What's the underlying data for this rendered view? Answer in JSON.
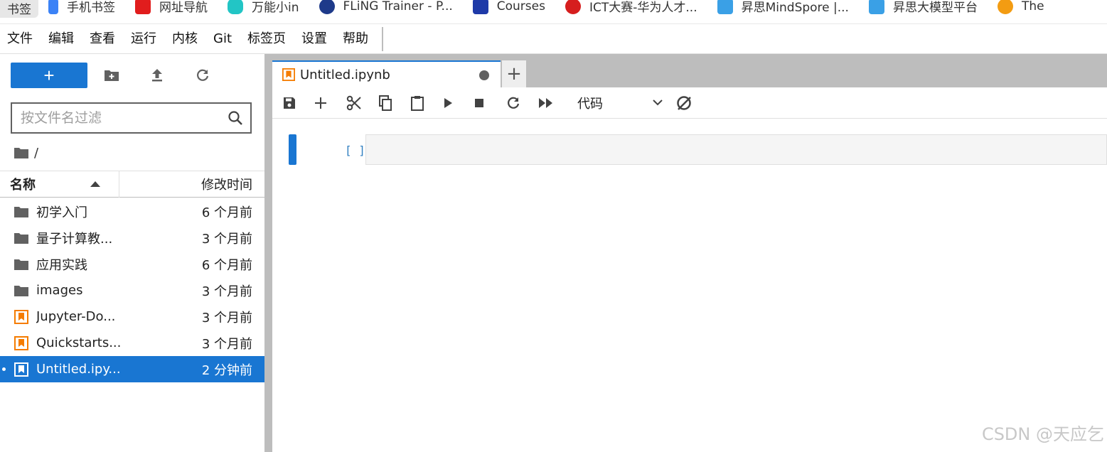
{
  "bookmarks": [
    {
      "label": "书签",
      "icon": "bookmark-icon",
      "color": "#e7e7e7"
    },
    {
      "label": "手机书签",
      "icon": "phone-icon",
      "color": "#3b82f6"
    },
    {
      "label": "网址导航",
      "icon": "nav-icon",
      "color": "#e11d1d"
    },
    {
      "label": "万能小in",
      "icon": "robot-icon",
      "color": "#22c5c5"
    },
    {
      "label": "FLiNG Trainer - P...",
      "icon": "globe-icon",
      "color": "#1e3a8a"
    },
    {
      "label": "Courses",
      "icon": "courses-icon",
      "color": "#1e3aa8"
    },
    {
      "label": "ICT大赛-华为人才...",
      "icon": "huawei-icon",
      "color": "#d61e1e"
    },
    {
      "label": "昇思MindSpore |...",
      "icon": "mindspore-icon",
      "color": "#3aa0e6"
    },
    {
      "label": "昇思大模型平台",
      "icon": "mindspore-icon",
      "color": "#3aa0e6"
    },
    {
      "label": "The",
      "icon": "hf-icon",
      "color": "#f39c12"
    }
  ],
  "menu": [
    "文件",
    "编辑",
    "查看",
    "运行",
    "内核",
    "Git",
    "标签页",
    "设置",
    "帮助"
  ],
  "filebrowser": {
    "new_label": "+",
    "filter_placeholder": "按文件名过滤",
    "path": "/",
    "col_name": "名称",
    "col_modified": "修改时间",
    "files": [
      {
        "name": "初学入门",
        "type": "folder",
        "modified": "6 个月前"
      },
      {
        "name": "量子计算教...",
        "type": "folder",
        "modified": "3 个月前"
      },
      {
        "name": "应用实践",
        "type": "folder",
        "modified": "6 个月前"
      },
      {
        "name": "images",
        "type": "folder",
        "modified": "3 个月前"
      },
      {
        "name": "Jupyter-Do...",
        "type": "notebook",
        "modified": "3 个月前"
      },
      {
        "name": "Quickstarts....",
        "type": "notebook",
        "modified": "3 个月前"
      },
      {
        "name": "Untitled.ipy...",
        "type": "notebook",
        "modified": "2 分钟前",
        "selected": true
      }
    ]
  },
  "notebook": {
    "tab_title": "Untitled.ipynb",
    "add_tab": "+",
    "cell_type": "代码",
    "prompt": "[ ]:"
  },
  "watermark": "CSDN @天应乞",
  "colors": {
    "accent": "#1976d2",
    "notebook_orange": "#f57c00",
    "divider": "#bdbdbd"
  }
}
